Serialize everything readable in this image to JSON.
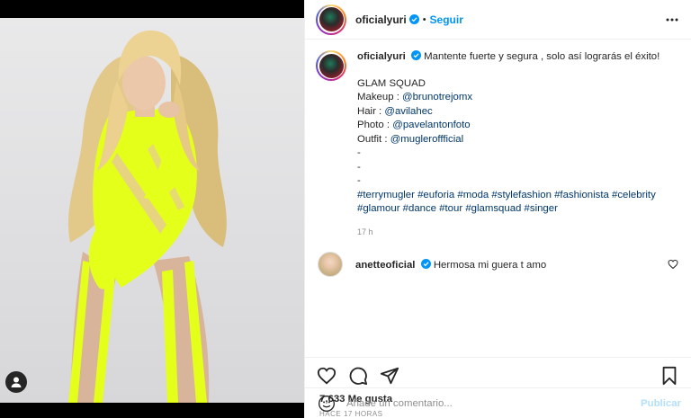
{
  "post": {
    "username": "oficialyuri",
    "follow_label": "Seguir",
    "separator": "•",
    "icons": {
      "verified": "verified-badge-icon",
      "more": "more-options-icon",
      "tag": "user-tag-icon"
    },
    "photo_alt": "Mujer rubia con body amarillo neón"
  },
  "caption": {
    "username": "oficialyuri",
    "text": "Mantente fuerte y segura , solo así lograrás el éxito!",
    "lines": [
      {
        "prefix": "GLAM SQUAD",
        "link": ""
      },
      {
        "prefix": "Makeup : ",
        "link": "@brunotrejomx"
      },
      {
        "prefix": "Hair : ",
        "link": "@avilahec"
      },
      {
        "prefix": "Photo : ",
        "link": "@pavelantonfoto"
      },
      {
        "prefix": "Outfit : ",
        "link": "@mugleroffficial"
      },
      {
        "prefix": "-",
        "link": ""
      },
      {
        "prefix": "-",
        "link": ""
      },
      {
        "prefix": "-",
        "link": ""
      }
    ],
    "hashtags_line1": "#terrymugler #euforia #moda #stylefashion #fashionista #celebrity",
    "hashtags_line2": "#glamour #dance #tour #glamsquad #singer",
    "time": "17 h"
  },
  "comment": {
    "username": "anetteoficial",
    "text": "Hermosa mi guera t amo"
  },
  "actions": {
    "like": "heart-icon",
    "comment": "comment-icon",
    "share": "share-icon",
    "save": "bookmark-icon"
  },
  "likes_label": "7,633 Me gusta",
  "posted_ago": "HACE 17 HORAS",
  "composer": {
    "placeholder": "Añade un comentario...",
    "publish_label": "Publicar",
    "emoji_icon": "emoji-icon"
  },
  "colors": {
    "accent": "#0095f6",
    "link": "#00376b",
    "muted": "#8e8e8e",
    "neon": "#e4ff1a"
  }
}
